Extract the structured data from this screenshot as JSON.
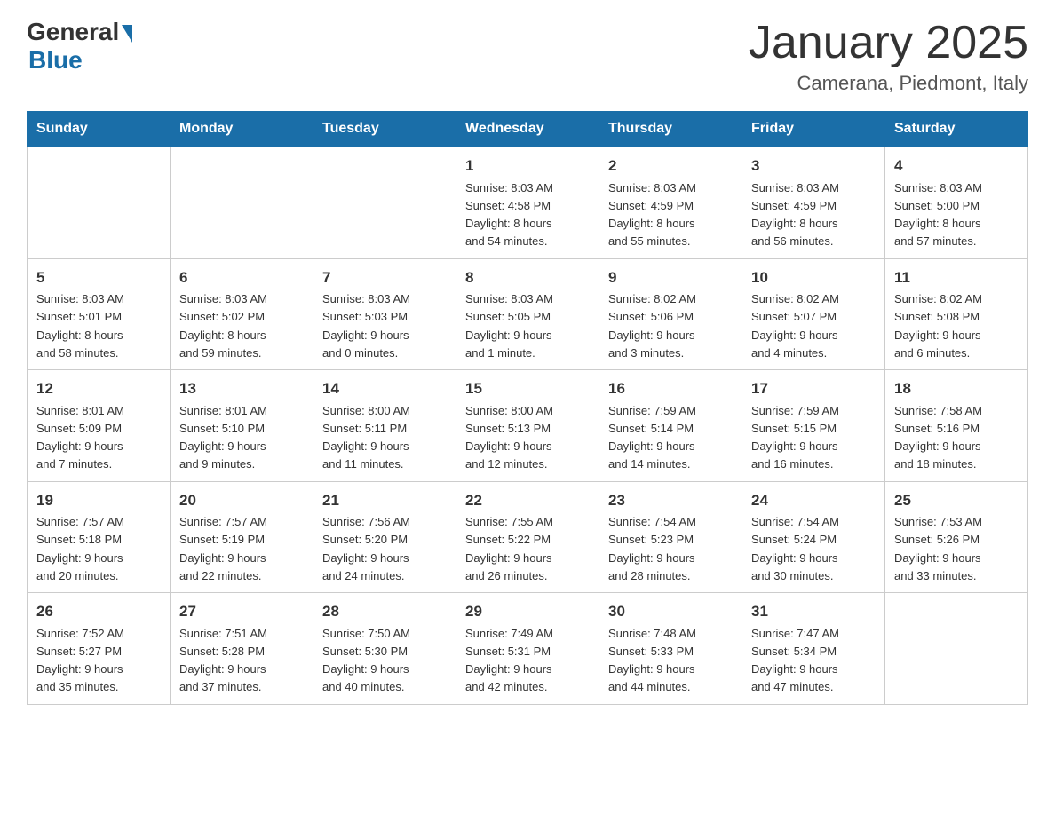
{
  "logo": {
    "text_general": "General",
    "text_blue": "Blue"
  },
  "title": "January 2025",
  "subtitle": "Camerana, Piedmont, Italy",
  "headers": [
    "Sunday",
    "Monday",
    "Tuesday",
    "Wednesday",
    "Thursday",
    "Friday",
    "Saturday"
  ],
  "weeks": [
    [
      {
        "day": "",
        "info": ""
      },
      {
        "day": "",
        "info": ""
      },
      {
        "day": "",
        "info": ""
      },
      {
        "day": "1",
        "info": "Sunrise: 8:03 AM\nSunset: 4:58 PM\nDaylight: 8 hours\nand 54 minutes."
      },
      {
        "day": "2",
        "info": "Sunrise: 8:03 AM\nSunset: 4:59 PM\nDaylight: 8 hours\nand 55 minutes."
      },
      {
        "day": "3",
        "info": "Sunrise: 8:03 AM\nSunset: 4:59 PM\nDaylight: 8 hours\nand 56 minutes."
      },
      {
        "day": "4",
        "info": "Sunrise: 8:03 AM\nSunset: 5:00 PM\nDaylight: 8 hours\nand 57 minutes."
      }
    ],
    [
      {
        "day": "5",
        "info": "Sunrise: 8:03 AM\nSunset: 5:01 PM\nDaylight: 8 hours\nand 58 minutes."
      },
      {
        "day": "6",
        "info": "Sunrise: 8:03 AM\nSunset: 5:02 PM\nDaylight: 8 hours\nand 59 minutes."
      },
      {
        "day": "7",
        "info": "Sunrise: 8:03 AM\nSunset: 5:03 PM\nDaylight: 9 hours\nand 0 minutes."
      },
      {
        "day": "8",
        "info": "Sunrise: 8:03 AM\nSunset: 5:05 PM\nDaylight: 9 hours\nand 1 minute."
      },
      {
        "day": "9",
        "info": "Sunrise: 8:02 AM\nSunset: 5:06 PM\nDaylight: 9 hours\nand 3 minutes."
      },
      {
        "day": "10",
        "info": "Sunrise: 8:02 AM\nSunset: 5:07 PM\nDaylight: 9 hours\nand 4 minutes."
      },
      {
        "day": "11",
        "info": "Sunrise: 8:02 AM\nSunset: 5:08 PM\nDaylight: 9 hours\nand 6 minutes."
      }
    ],
    [
      {
        "day": "12",
        "info": "Sunrise: 8:01 AM\nSunset: 5:09 PM\nDaylight: 9 hours\nand 7 minutes."
      },
      {
        "day": "13",
        "info": "Sunrise: 8:01 AM\nSunset: 5:10 PM\nDaylight: 9 hours\nand 9 minutes."
      },
      {
        "day": "14",
        "info": "Sunrise: 8:00 AM\nSunset: 5:11 PM\nDaylight: 9 hours\nand 11 minutes."
      },
      {
        "day": "15",
        "info": "Sunrise: 8:00 AM\nSunset: 5:13 PM\nDaylight: 9 hours\nand 12 minutes."
      },
      {
        "day": "16",
        "info": "Sunrise: 7:59 AM\nSunset: 5:14 PM\nDaylight: 9 hours\nand 14 minutes."
      },
      {
        "day": "17",
        "info": "Sunrise: 7:59 AM\nSunset: 5:15 PM\nDaylight: 9 hours\nand 16 minutes."
      },
      {
        "day": "18",
        "info": "Sunrise: 7:58 AM\nSunset: 5:16 PM\nDaylight: 9 hours\nand 18 minutes."
      }
    ],
    [
      {
        "day": "19",
        "info": "Sunrise: 7:57 AM\nSunset: 5:18 PM\nDaylight: 9 hours\nand 20 minutes."
      },
      {
        "day": "20",
        "info": "Sunrise: 7:57 AM\nSunset: 5:19 PM\nDaylight: 9 hours\nand 22 minutes."
      },
      {
        "day": "21",
        "info": "Sunrise: 7:56 AM\nSunset: 5:20 PM\nDaylight: 9 hours\nand 24 minutes."
      },
      {
        "day": "22",
        "info": "Sunrise: 7:55 AM\nSunset: 5:22 PM\nDaylight: 9 hours\nand 26 minutes."
      },
      {
        "day": "23",
        "info": "Sunrise: 7:54 AM\nSunset: 5:23 PM\nDaylight: 9 hours\nand 28 minutes."
      },
      {
        "day": "24",
        "info": "Sunrise: 7:54 AM\nSunset: 5:24 PM\nDaylight: 9 hours\nand 30 minutes."
      },
      {
        "day": "25",
        "info": "Sunrise: 7:53 AM\nSunset: 5:26 PM\nDaylight: 9 hours\nand 33 minutes."
      }
    ],
    [
      {
        "day": "26",
        "info": "Sunrise: 7:52 AM\nSunset: 5:27 PM\nDaylight: 9 hours\nand 35 minutes."
      },
      {
        "day": "27",
        "info": "Sunrise: 7:51 AM\nSunset: 5:28 PM\nDaylight: 9 hours\nand 37 minutes."
      },
      {
        "day": "28",
        "info": "Sunrise: 7:50 AM\nSunset: 5:30 PM\nDaylight: 9 hours\nand 40 minutes."
      },
      {
        "day": "29",
        "info": "Sunrise: 7:49 AM\nSunset: 5:31 PM\nDaylight: 9 hours\nand 42 minutes."
      },
      {
        "day": "30",
        "info": "Sunrise: 7:48 AM\nSunset: 5:33 PM\nDaylight: 9 hours\nand 44 minutes."
      },
      {
        "day": "31",
        "info": "Sunrise: 7:47 AM\nSunset: 5:34 PM\nDaylight: 9 hours\nand 47 minutes."
      },
      {
        "day": "",
        "info": ""
      }
    ]
  ]
}
